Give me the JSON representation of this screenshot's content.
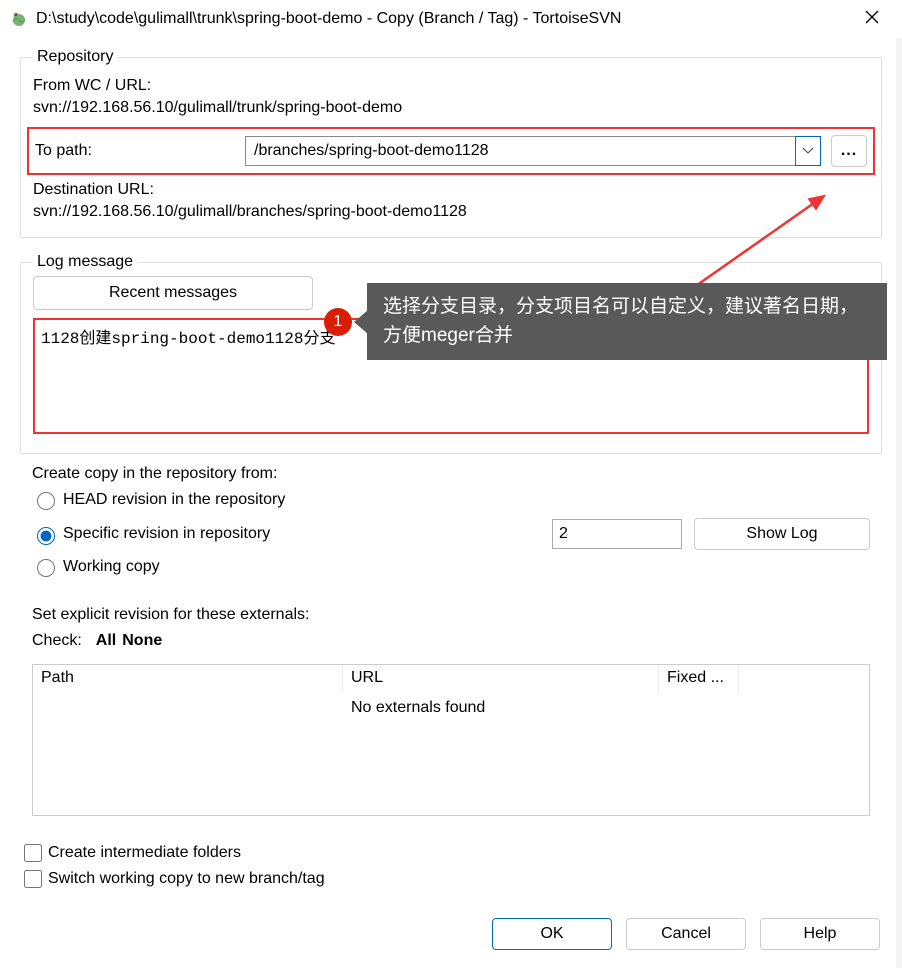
{
  "titlebar": {
    "title": "D:\\study\\code\\gulimall\\trunk\\spring-boot-demo - Copy (Branch / Tag) - TortoiseSVN"
  },
  "repository": {
    "legend": "Repository",
    "from_label": "From WC / URL:",
    "from_url": "svn://192.168.56.10/gulimall/trunk/spring-boot-demo",
    "to_label": "To path:",
    "to_value": "/branches/spring-boot-demo1128",
    "browse_label": "...",
    "dest_label": "Destination URL:",
    "dest_url": "svn://192.168.56.10/gulimall/branches/spring-boot-demo1128"
  },
  "log": {
    "legend": "Log message",
    "recent_label": "Recent messages",
    "textarea_value": "1128创建spring-boot-demo1128分支"
  },
  "copyfrom": {
    "label": "Create copy in the repository from:",
    "head_label": "HEAD revision in the repository",
    "specific_label": "Specific revision in repository",
    "wc_label": "Working copy",
    "revision_value": "2",
    "showlog_label": "Show Log"
  },
  "externals": {
    "label": "Set explicit revision for these externals:",
    "check_label": "Check:",
    "all_label": "All",
    "none_label": "None",
    "col_path": "Path",
    "col_url": "URL",
    "col_fixed": "Fixed ...",
    "empty_text": "No externals found"
  },
  "checks": {
    "intermediate": "Create intermediate folders",
    "switch": "Switch working copy to new branch/tag"
  },
  "buttons": {
    "ok": "OK",
    "cancel": "Cancel",
    "help": "Help"
  },
  "annotation": {
    "num": "1",
    "text": "选择分支目录，分支项目名可以自定义，建议著名日期，方便meger合并"
  }
}
